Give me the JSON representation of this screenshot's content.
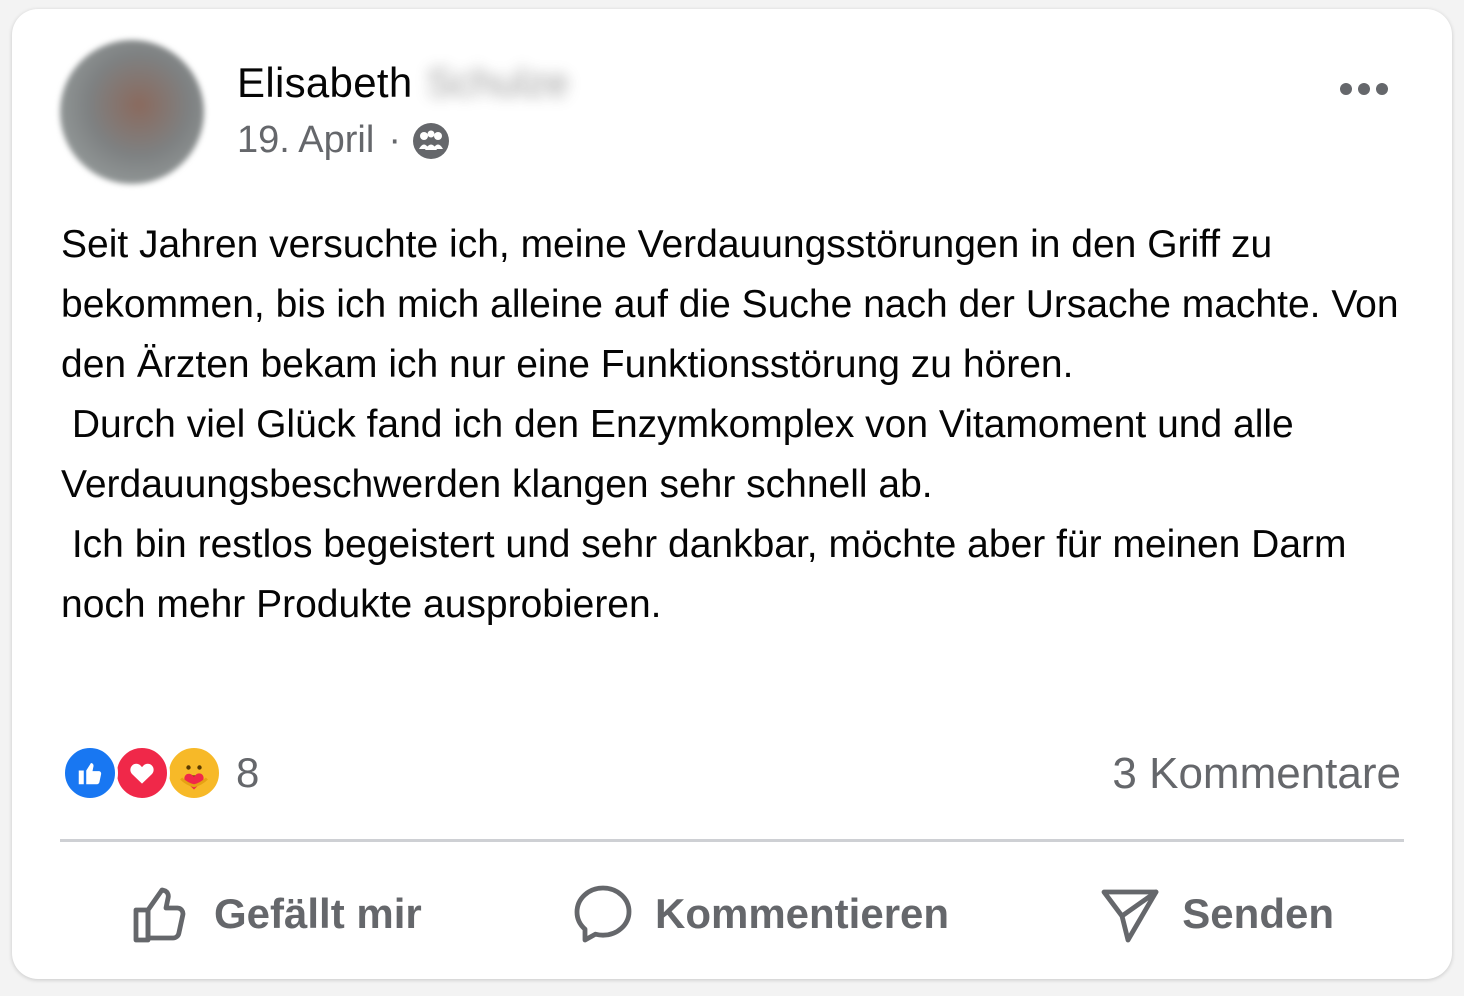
{
  "post": {
    "author_first": "Elisabeth",
    "author_last": "Schulze",
    "date": "19. April",
    "separator": "·",
    "audience_icon": "friends-icon",
    "more_icon": "more-horizontal-icon",
    "text": "Seit Jahren versuchte ich, meine Verdauungsstörungen in den Griff zu bekommen, bis ich mich alleine auf die Suche nach der Ursache machte. Von den Ärzten bekam ich nur eine Funktionsstörung zu hören.\n Durch viel Glück fand ich den Enzymkomplex von Vitamoment und alle Verdauungsbeschwerden klangen sehr schnell ab.\n Ich bin restlos begeistert und sehr dankbar, möchte aber für meinen Darm noch mehr Produkte ausprobieren."
  },
  "reactions": {
    "types": [
      "like",
      "love",
      "care"
    ],
    "count": "8"
  },
  "comments": {
    "label": "3 Kommentare"
  },
  "actions": {
    "like_label": "Gefällt mir",
    "comment_label": "Kommentieren",
    "send_label": "Senden"
  },
  "colors": {
    "like_blue": "#1877f2",
    "love_red": "#f02849",
    "care_yellow": "#f7b928",
    "secondary_text": "#65676b"
  }
}
